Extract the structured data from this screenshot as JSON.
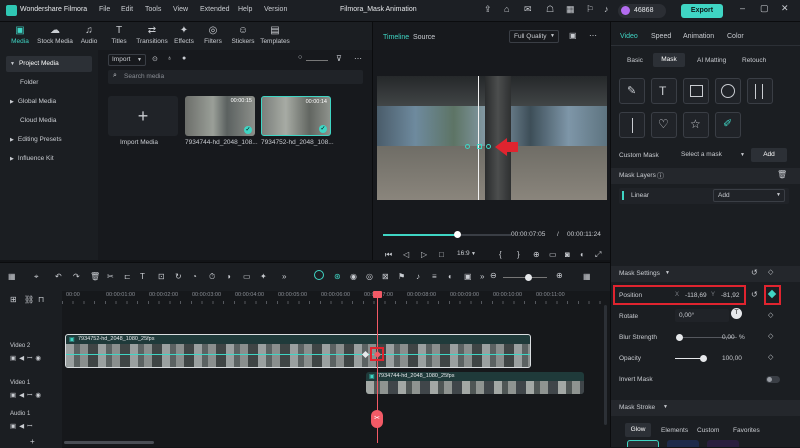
{
  "app": {
    "name": "Wondershare Filmora",
    "project_title": "Filmora_Mask Animation",
    "credits": "46868",
    "export_label": "Export",
    "menu": [
      "File",
      "Edit",
      "Tools",
      "View",
      "Extended",
      "Help",
      "Version"
    ]
  },
  "nav_tabs": [
    {
      "label": "Media",
      "icon": "▣"
    },
    {
      "label": "Stock Media",
      "icon": "☁"
    },
    {
      "label": "Audio",
      "icon": "♫"
    },
    {
      "label": "Titles",
      "icon": "T"
    },
    {
      "label": "Transitions",
      "icon": "⇄"
    },
    {
      "label": "Effects",
      "icon": "✦"
    },
    {
      "label": "Filters",
      "icon": "◎"
    },
    {
      "label": "Stickers",
      "icon": "☺"
    },
    {
      "label": "Templates",
      "icon": "▤"
    }
  ],
  "sidebar": {
    "items": [
      {
        "label": "Project Media"
      },
      {
        "label": "Folder"
      },
      {
        "label": "Global Media"
      },
      {
        "label": "Cloud Media"
      },
      {
        "label": "Editing Presets"
      },
      {
        "label": "Influence Kit"
      }
    ]
  },
  "media": {
    "import_label": "Import",
    "search_placeholder": "Search media",
    "import_tile_label": "Import Media",
    "items": [
      {
        "name": "7934744-hd_2048_108...",
        "duration": "00:00:15"
      },
      {
        "name": "7934752-hd_2048_108...",
        "duration": "00:00:14"
      }
    ]
  },
  "preview": {
    "tab_timeline": "Timeline",
    "tab_source": "Source",
    "quality": "Full Quality",
    "current_time": "00:00:07:05",
    "separator": "/",
    "total_time": "00:00:11:24",
    "aspect": "16:9",
    "progress": 0.58
  },
  "props": {
    "tabs": [
      "Video",
      "Speed",
      "Animation",
      "Color"
    ],
    "subtabs": [
      "Basic",
      "Mask",
      "AI Matting",
      "Retouch"
    ],
    "custom_mask_label": "Custom Mask",
    "select_mask": "Select a mask",
    "add_label": "Add",
    "mask_layers_label": "Mask Layers",
    "layer_name": "Linear",
    "layer_add": "Add",
    "mask_settings_label": "Mask Settings",
    "position_label": "Position",
    "pos_x_axis": "X",
    "pos_x": "-118,69",
    "pos_y_axis": "Y",
    "pos_y": "-81,92",
    "rotate_label": "Rotate",
    "rotate_value": "0,00°",
    "blur_label": "Blur Strength",
    "blur_value": "0,00",
    "blur_unit": "%",
    "blur_fraction": 0.0,
    "opacity_label": "Opacity",
    "opacity_value": "100,00",
    "opacity_fraction": 1.0,
    "invert_label": "Invert Mask",
    "mask_stroke_label": "Mask Stroke",
    "stroke_tabs": [
      "Glow",
      "Elements",
      "Custom",
      "Favorites"
    ]
  },
  "timeline": {
    "ruler": [
      "00:00",
      "00:00:01:00",
      "00:00:02:00",
      "00:00:03:00",
      "00:00:04:00",
      "00:00:05:00",
      "00:00:06:00",
      "00:00:07:00",
      "00:00:08:00",
      "00:00:09:00",
      "00:00:10:00",
      "00:00:11:00"
    ],
    "tracks": [
      {
        "label": "Video 2"
      },
      {
        "label": "Video 1"
      },
      {
        "label": "Audio 1"
      }
    ],
    "clip_v2": "7934752-hd_2048_1080_25fps",
    "clip_v1": "7934744-hd_2048_1080_25fps"
  }
}
